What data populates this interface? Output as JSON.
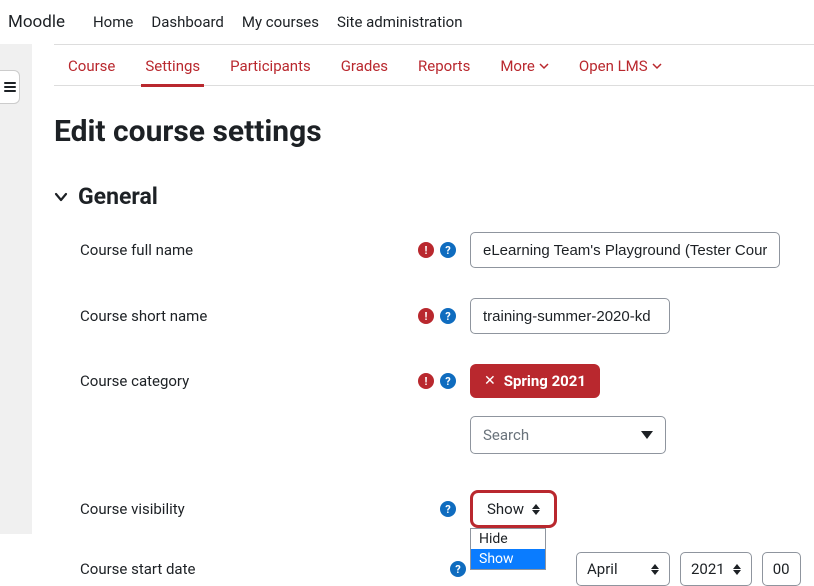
{
  "brand": "Moodle",
  "topnav": {
    "home": "Home",
    "dashboard": "Dashboard",
    "mycourses": "My courses",
    "siteadmin": "Site administration"
  },
  "subnav": {
    "course": "Course",
    "settings": "Settings",
    "participants": "Participants",
    "grades": "Grades",
    "reports": "Reports",
    "more": "More",
    "openlms": "Open LMS"
  },
  "page_title": "Edit course settings",
  "section_general": "General",
  "labels": {
    "fullname": "Course full name",
    "shortname": "Course short name",
    "category": "Course category",
    "visibility": "Course visibility",
    "startdate": "Course start date"
  },
  "icons": {
    "required": "!",
    "help": "?"
  },
  "values": {
    "fullname": "eLearning Team's Playground (Tester Course)",
    "shortname": "training-summer-2020-kd",
    "category_tag": "Spring 2021",
    "category_search_placeholder": "Search",
    "visibility_selected": "Show",
    "visibility_options": {
      "hide": "Hide",
      "show": "Show"
    },
    "startdate_month": "April",
    "startdate_year": "2021",
    "startdate_hour": "00"
  }
}
